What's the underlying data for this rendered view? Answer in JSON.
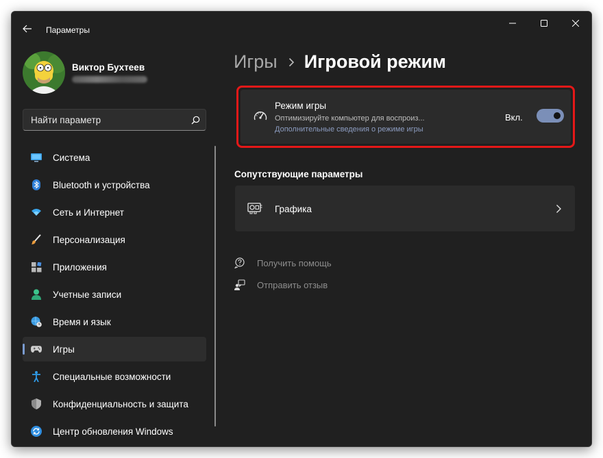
{
  "window": {
    "title": "Параметры",
    "controls": {
      "minimize": "minimize-icon",
      "maximize": "maximize-icon",
      "close": "close-icon"
    }
  },
  "profile": {
    "name": "Виктор Бухтеев"
  },
  "search": {
    "placeholder": "Найти параметр"
  },
  "sidebar": {
    "items": [
      {
        "label": "Система",
        "icon": "monitor-icon",
        "active": false
      },
      {
        "label": "Bluetooth и устройства",
        "icon": "bluetooth-icon",
        "active": false
      },
      {
        "label": "Сеть и Интернет",
        "icon": "wifi-icon",
        "active": false
      },
      {
        "label": "Персонализация",
        "icon": "brush-icon",
        "active": false
      },
      {
        "label": "Приложения",
        "icon": "apps-icon",
        "active": false
      },
      {
        "label": "Учетные записи",
        "icon": "person-icon",
        "active": false
      },
      {
        "label": "Время и язык",
        "icon": "globe-clock-icon",
        "active": false
      },
      {
        "label": "Игры",
        "icon": "gamepad-icon",
        "active": true
      },
      {
        "label": "Специальные возможности",
        "icon": "accessibility-icon",
        "active": false
      },
      {
        "label": "Конфиденциальность и защита",
        "icon": "shield-icon",
        "active": false
      },
      {
        "label": "Центр обновления Windows",
        "icon": "update-icon",
        "active": false
      }
    ]
  },
  "breadcrumb": {
    "parent": "Игры",
    "current": "Игровой режим"
  },
  "game_mode": {
    "title": "Режим игры",
    "description": "Оптимизируйте компьютер для воспроиз...",
    "link": "Дополнительные сведения о режиме игры",
    "toggle_label": "Вкл.",
    "toggle_on": true
  },
  "related": {
    "title": "Сопутствующие параметры",
    "items": [
      {
        "label": "Графика",
        "icon": "graphics-card-icon"
      }
    ]
  },
  "help": {
    "get_help": "Получить помощь",
    "feedback": "Отправить отзыв"
  },
  "colors": {
    "accent": "#7b8fb8",
    "highlight_frame": "#e51818",
    "background": "#202020",
    "card": "#2b2b2b"
  }
}
